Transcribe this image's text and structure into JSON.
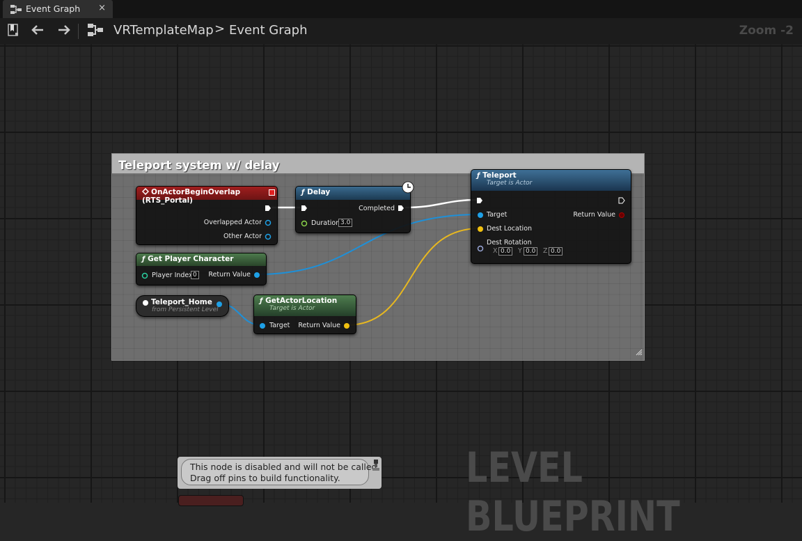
{
  "tab": {
    "label": "Event Graph",
    "close": "×"
  },
  "breadcrumb": {
    "map": "VRTemplateMap",
    "separator": ">",
    "graph": "Event Graph"
  },
  "zoom": "Zoom -2",
  "comment": {
    "title": "Teleport system w/ delay"
  },
  "nodes": {
    "overlap": {
      "title": "OnActorBeginOverlap (RTS_Portal)",
      "pins": [
        "Overlapped Actor",
        "Other Actor"
      ]
    },
    "delay": {
      "title": "Delay",
      "completed": "Completed",
      "duration_label": "Duration",
      "duration_value": "3.0"
    },
    "teleport": {
      "title": "Teleport",
      "subtitle": "Target is Actor",
      "target": "Target",
      "return_value": "Return Value",
      "dest_location": "Dest Location",
      "dest_rotation": "Dest Rotation",
      "x_label": "X",
      "x_value": "0.0",
      "y_label": "Y",
      "y_value": "0.0",
      "z_label": "Z",
      "z_value": "0.0"
    },
    "get_player": {
      "title": "Get Player Character",
      "player_index": "Player Index",
      "player_index_value": "0",
      "return_value": "Return Value"
    },
    "teleport_home": {
      "title": "Teleport_Home",
      "subtitle": "from Persistent Level"
    },
    "get_location": {
      "title": "GetActorLocation",
      "subtitle": "Target is Actor",
      "target": "Target",
      "return_value": "Return Value"
    }
  },
  "tooltip": {
    "line1": "This node is disabled and will not be called.",
    "line2": "Drag off pins to build functionality."
  },
  "watermark": "LEVEL BLUEPRINT",
  "colors": {
    "event_red": "#8b1a1a",
    "function_blue": "#2b5574",
    "pure_green": "#3f6b3f",
    "object_pin": "#1ea0e6",
    "vector_pin": "#f0c010",
    "float_pin": "#8ad34a"
  }
}
